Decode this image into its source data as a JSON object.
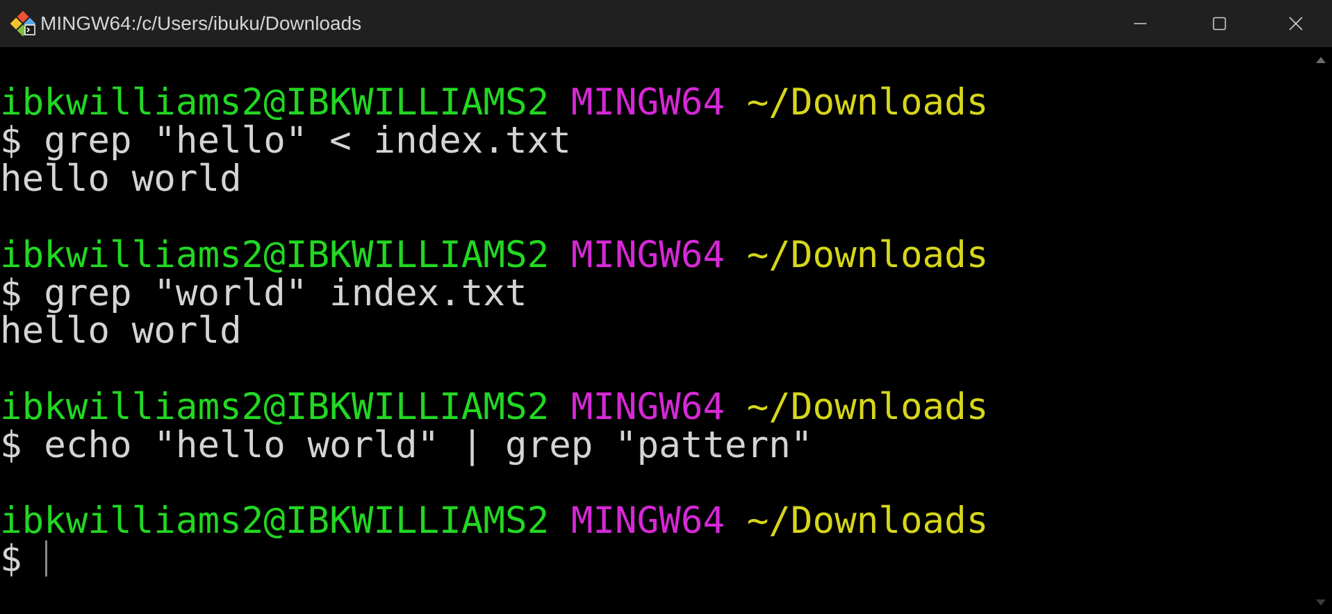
{
  "window": {
    "title": "MINGW64:/c/Users/ibuku/Downloads",
    "icon": "git-bash-icon"
  },
  "controls": {
    "minimize_icon": "minimize-icon",
    "maximize_icon": "maximize-icon",
    "close_icon": "close-icon"
  },
  "colors": {
    "user_host": "#22d722",
    "system": "#d628d6",
    "path": "#d6d61c",
    "text": "#d4d4d4",
    "titlebar": "#202020"
  },
  "terminal": {
    "blocks": [
      {
        "prompt": {
          "user_host": "ibkwilliams2@IBKWILLIAMS2",
          "system": "MINGW64",
          "path": "~/Downloads"
        },
        "command": "$ grep \"hello\" < index.txt",
        "output": "hello world"
      },
      {
        "prompt": {
          "user_host": "ibkwilliams2@IBKWILLIAMS2",
          "system": "MINGW64",
          "path": "~/Downloads"
        },
        "command": "$ grep \"world\" index.txt",
        "output": "hello world"
      },
      {
        "prompt": {
          "user_host": "ibkwilliams2@IBKWILLIAMS2",
          "system": "MINGW64",
          "path": "~/Downloads"
        },
        "command": "$ echo \"hello world\" | grep \"pattern\""
      },
      {
        "prompt": {
          "user_host": "ibkwilliams2@IBKWILLIAMS2",
          "system": "MINGW64",
          "path": "~/Downloads"
        },
        "command": "$ "
      }
    ]
  }
}
